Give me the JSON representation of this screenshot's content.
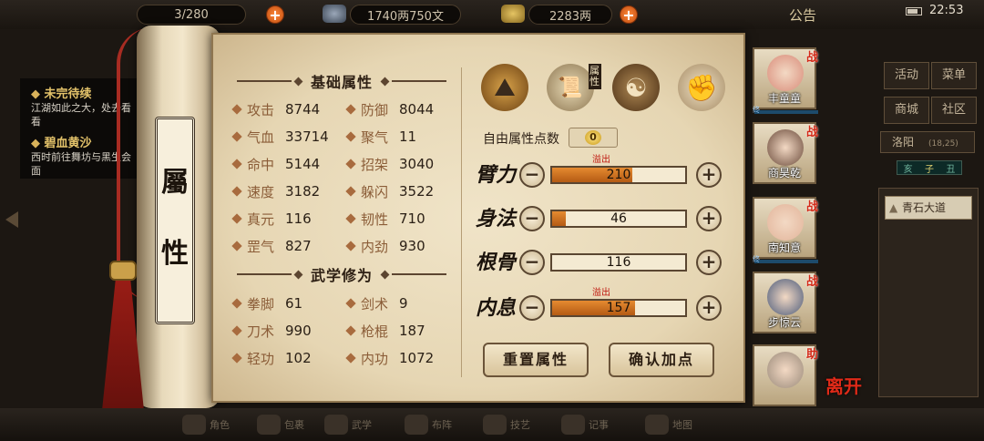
{
  "topbar": {
    "capacity": "3/280",
    "money": "1740两750文",
    "gold": "2283两",
    "announcement": "公告",
    "clock": "22:53"
  },
  "quests": [
    {
      "title": "未完待续",
      "desc": "江湖如此之大，处去看看"
    },
    {
      "title": "碧血黄沙",
      "desc": "西时前往舞坊与黑生会面"
    }
  ],
  "scroll_label": [
    "屬",
    "性"
  ],
  "basic_attrs": {
    "heading": "基础属性",
    "rows": [
      [
        {
          "name": "攻击",
          "value": "8744"
        },
        {
          "name": "防御",
          "value": "8044"
        }
      ],
      [
        {
          "name": "气血",
          "value": "33714"
        },
        {
          "name": "聚气",
          "value": "11"
        }
      ],
      [
        {
          "name": "命中",
          "value": "5144"
        },
        {
          "name": "招架",
          "value": "3040"
        }
      ],
      [
        {
          "name": "速度",
          "value": "3182"
        },
        {
          "name": "躲闪",
          "value": "3522"
        }
      ],
      [
        {
          "name": "真元",
          "value": "116"
        },
        {
          "name": "韧性",
          "value": "710"
        }
      ],
      [
        {
          "name": "罡气",
          "value": "827"
        },
        {
          "name": "内劲",
          "value": "930"
        }
      ]
    ]
  },
  "martial_attrs": {
    "heading": "武学修为",
    "rows": [
      [
        {
          "name": "拳脚",
          "value": "61"
        },
        {
          "name": "剑术",
          "value": "9"
        }
      ],
      [
        {
          "name": "刀术",
          "value": "990"
        },
        {
          "name": "枪棍",
          "value": "187"
        }
      ],
      [
        {
          "name": "轻功",
          "value": "102"
        },
        {
          "name": "内功",
          "value": "1072"
        }
      ]
    ]
  },
  "tabs": [
    {
      "icon": "straw-hat-icon"
    },
    {
      "icon": "scroll-icon",
      "label": "属性"
    },
    {
      "icon": "bagua-icon"
    },
    {
      "icon": "body-meridian-icon"
    }
  ],
  "free_points": {
    "label": "自由属性点数",
    "value": "0"
  },
  "allocation": [
    {
      "label": "臂力",
      "value": "210",
      "fill": 0.6,
      "overflow": "溢出"
    },
    {
      "label": "身法",
      "value": "46",
      "fill": 0.1,
      "overflow": ""
    },
    {
      "label": "根骨",
      "value": "116",
      "fill": 0.0,
      "overflow": ""
    },
    {
      "label": "内息",
      "value": "157",
      "fill": 0.62,
      "overflow": "溢出"
    }
  ],
  "buttons": {
    "reset": "重置属性",
    "confirm": "确认加点"
  },
  "party": [
    {
      "name": "丰童童",
      "badge": "战",
      "face": "#d98c7a",
      "tag": "终"
    },
    {
      "name": "商昊乾",
      "badge": "战",
      "face": "#6a4a3a",
      "tag": ""
    },
    {
      "name": "南知意",
      "badge": "战",
      "face": "#e2b49a",
      "tag": "终"
    },
    {
      "name": "步惊云",
      "badge": "战",
      "face": "#4a5a7a",
      "tag": ""
    },
    {
      "name": "",
      "badge": "助",
      "face": "#9a8a7a",
      "tag": ""
    }
  ],
  "leave_label": "离开",
  "right_menu": {
    "activity": "活动",
    "menu": "菜单",
    "shop": "商城",
    "community": "社区",
    "location": "洛阳",
    "coords": "(18,25)",
    "time_marks": [
      "亥",
      "子",
      "丑"
    ],
    "road": "青石大道"
  },
  "bottom_items": [
    "角色",
    "包裹",
    "武学",
    "布阵",
    "技艺",
    "记事",
    "地图"
  ]
}
